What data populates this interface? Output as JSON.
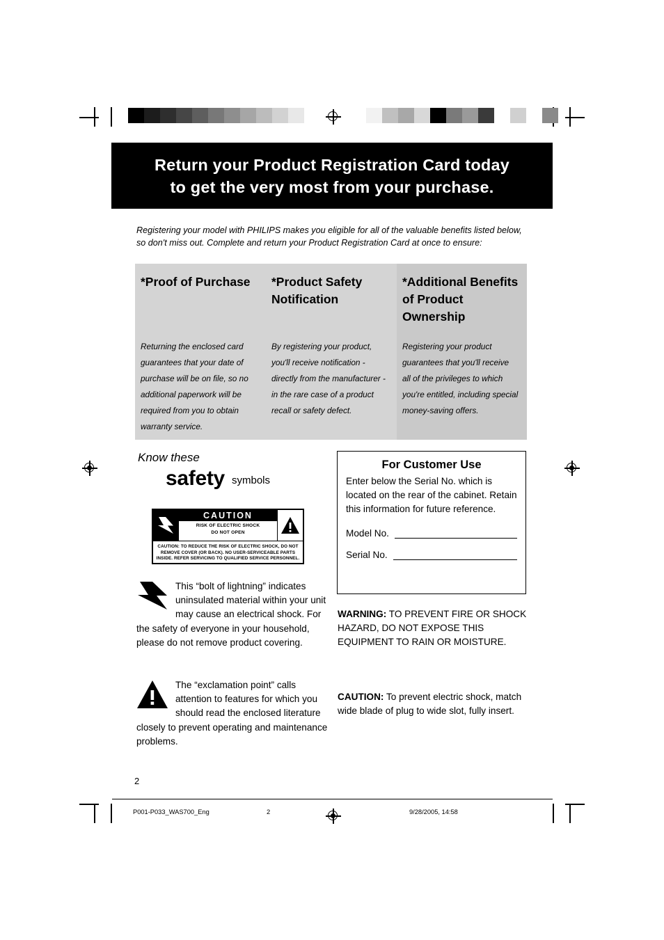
{
  "banner": {
    "line1": "Return your Product Registration Card today",
    "line2": "to get the very most from your purchase."
  },
  "intro": "Registering your model with PHILIPS makes you eligible for all of the valuable benefits listed below, so don't miss out. Complete and return your Product Registration Card at once to ensure:",
  "panel": {
    "columns": [
      {
        "heading": "*Proof of Purchase",
        "body": "Returning the enclosed card guarantees that your date of purchase will be on file, so no additional paperwork will be required from you to obtain warranty service."
      },
      {
        "heading": "*Product Safety Notification",
        "body": "By registering your product, you'll receive notification - directly from the manufacturer - in the rare case of a product recall or safety defect."
      },
      {
        "heading": "*Additional Benefits of Product Ownership",
        "body": "Registering your product guarantees that you'll receive all of the privileges to which you're entitled, including special money-saving offers."
      }
    ]
  },
  "safety": {
    "know_these": "Know these",
    "word": "safety",
    "sub": "symbols"
  },
  "caution_label": {
    "caution": "CAUTION",
    "risk_line1": "RISK OF ELECTRIC SHOCK",
    "risk_line2": "DO NOT OPEN",
    "fine_line1": "CAUTION: TO REDUCE THE RISK OF ELECTRIC SHOCK, DO NOT",
    "fine_line2": "REMOVE COVER (OR BACK). NO USER-SERVICEABLE PARTS",
    "fine_line3": "INSIDE. REFER SERVICING TO QUALIFIED SERVICE PERSONNEL."
  },
  "symbol_explanations": {
    "bolt": "This “bolt of lightning” indicates uninsulated material within your unit may cause an electrical shock. For the safety of everyone in your household, please do not remove product covering.",
    "exclamation": "The “exclamation point” calls attention to features for which you should read the enclosed literature closely to prevent operating and maintenance problems."
  },
  "customer_use": {
    "title": "For Customer Use",
    "body": "Enter below the Serial No. which is located on the rear of the cabinet. Retain this information for future reference.",
    "model_label": "Model No.",
    "model_value": "",
    "serial_label": "Serial No.",
    "serial_value": ""
  },
  "warning": {
    "label": "WARNING:",
    "text": " TO PREVENT FIRE OR SHOCK HAZARD, DO NOT EXPOSE THIS EQUIPMENT TO RAIN OR MOISTURE."
  },
  "caution": {
    "label": "CAUTION:",
    "text": " To prevent electric shock, match wide blade of plug to wide slot, fully insert."
  },
  "page_number": "2",
  "footer": {
    "file": "P001-P033_WAS700_Eng",
    "page": "2",
    "date": "9/28/2005, 14:58"
  },
  "calibration": {
    "left_bar": [
      "#000000",
      "#1c1c1c",
      "#2e2e2e",
      "#464646",
      "#5e5e5e",
      "#787878",
      "#8e8e8e",
      "#a6a6a6",
      "#bcbcbc",
      "#d2d2d2",
      "#e8e8e8",
      "#ffffff"
    ],
    "right_bar": [
      "#f2f2f2",
      "#c0c0c0",
      "#a8a8a8",
      "#d8d8d8",
      "#000000",
      "#7a7a7a",
      "#9a9a9a",
      "#3a3a3a",
      "#ffffff",
      "#d0d0d0",
      "#ffffff",
      "#8a8a8a"
    ]
  }
}
